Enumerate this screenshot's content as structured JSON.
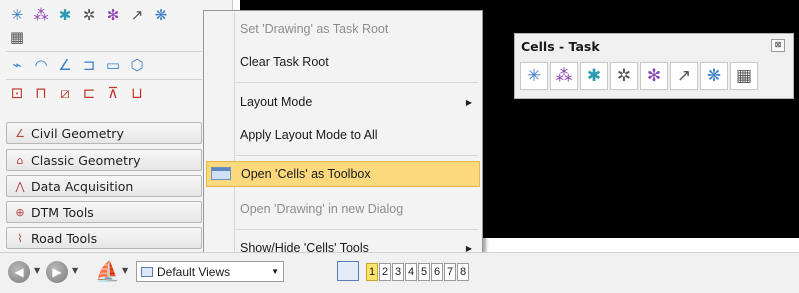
{
  "task_panel": {
    "icon_rows": [
      [
        "place-cell-icon",
        "cell-matrix-icon",
        "select-place-icon",
        "define-origin-icon",
        "identify-cell-icon",
        "replace-cell-icon",
        "multi-cell-icon"
      ],
      [
        "table-icon"
      ],
      [
        "line-icon",
        "arc-icon",
        "angle-icon",
        "beam-icon",
        "rect-icon",
        "solid-icon"
      ],
      [
        "frame-icon",
        "bracket-icon",
        "dimension-icon",
        "ortho-icon",
        "height-icon",
        "box-icon"
      ]
    ],
    "categories": [
      {
        "label": "Civil Geometry",
        "icon": "civil-geometry-icon"
      },
      {
        "label": "Classic Geometry",
        "icon": "classic-geometry-icon"
      },
      {
        "label": "Data Acquisition",
        "icon": "data-acquisition-icon"
      },
      {
        "label": "DTM Tools",
        "icon": "dtm-tools-icon"
      },
      {
        "label": "Road Tools",
        "icon": "road-tools-icon"
      }
    ]
  },
  "context_menu": {
    "items": [
      {
        "label": "Set 'Drawing' as Task Root",
        "disabled": true
      },
      {
        "label": "Clear Task Root",
        "disabled": false
      },
      {
        "label": "Layout Mode",
        "submenu": true
      },
      {
        "label": "Apply Layout Mode to All",
        "disabled": false
      },
      {
        "label": "Open 'Cells' as Toolbox",
        "highlighted": true
      },
      {
        "label": "Open 'Drawing' in new Dialog",
        "disabled": true
      },
      {
        "label": "Show/Hide 'Cells' Tools",
        "submenu": true
      }
    ]
  },
  "cells_task": {
    "title": "Cells - Task",
    "close_glyph": "⊠",
    "icons": [
      "place-cell-icon",
      "cell-matrix-icon",
      "select-place-icon",
      "define-origin-icon",
      "identify-cell-icon",
      "replace-cell-icon",
      "multi-cell-icon",
      "table-icon"
    ]
  },
  "bottom_bar": {
    "views_label": "Default Views",
    "view_numbers": [
      "1",
      "2",
      "3",
      "4",
      "5",
      "6",
      "7",
      "8"
    ],
    "active_view": "1"
  },
  "colors": {
    "highlight": "#fbd97c",
    "view_background": "#000000",
    "active_view": "#fde36b"
  }
}
